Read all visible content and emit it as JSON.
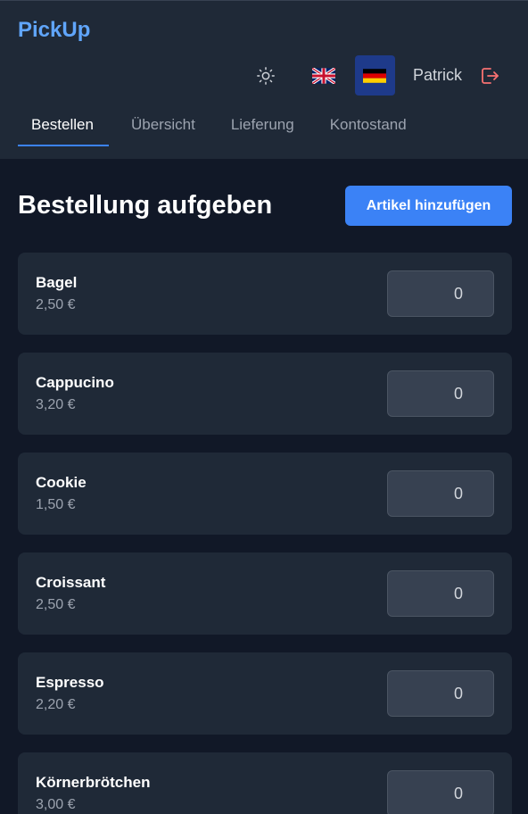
{
  "brand": "PickUp",
  "header": {
    "theme_icon": "sun-icon",
    "flags": {
      "english": "uk-flag-icon",
      "german": "germany-flag-icon"
    },
    "user_name": "Patrick",
    "logout_icon": "logout-icon"
  },
  "tabs": [
    {
      "label": "Bestellen",
      "active": true
    },
    {
      "label": "Übersicht",
      "active": false
    },
    {
      "label": "Lieferung",
      "active": false
    },
    {
      "label": "Kontostand",
      "active": false
    }
  ],
  "page": {
    "title": "Bestellung aufgeben",
    "add_button": "Artikel hinzufügen"
  },
  "items": [
    {
      "name": "Bagel",
      "price": "2,50 €",
      "quantity": "0"
    },
    {
      "name": "Cappucino",
      "price": "3,20 €",
      "quantity": "0"
    },
    {
      "name": "Cookie",
      "price": "1,50 €",
      "quantity": "0"
    },
    {
      "name": "Croissant",
      "price": "2,50 €",
      "quantity": "0"
    },
    {
      "name": "Espresso",
      "price": "2,20 €",
      "quantity": "0"
    },
    {
      "name": "Körnerbrötchen",
      "price": "3,00 €",
      "quantity": "0"
    }
  ],
  "colors": {
    "background": "#111827",
    "surface": "#1f2937",
    "accent": "#3b82f6",
    "brand": "#60a5fa",
    "logout": "#f87171"
  }
}
